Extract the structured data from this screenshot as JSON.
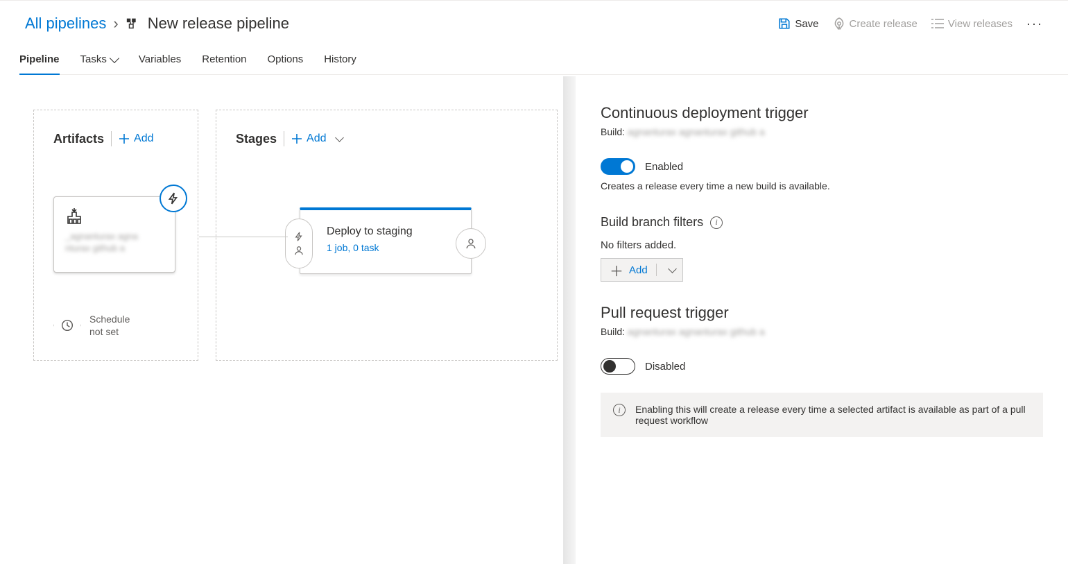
{
  "breadcrumb": {
    "root": "All pipelines",
    "title": "New release pipeline"
  },
  "header": {
    "save": "Save",
    "create": "Create release",
    "view": "View releases"
  },
  "tabs": [
    "Pipeline",
    "Tasks",
    "Variables",
    "Retention",
    "Options",
    "History"
  ],
  "artifacts": {
    "title": "Artifacts",
    "add": "Add",
    "source_masked": "_agnanturax agna nturax github a",
    "schedule": "Schedule\nnot set"
  },
  "stages": {
    "title": "Stages",
    "add": "Add",
    "stage": {
      "name": "Deploy to staging",
      "sub": "1 job, 0 task"
    }
  },
  "panel": {
    "cd_title": "Continuous deployment trigger",
    "build_label": "Build:",
    "build_masked": "agnanturax agnanturax github a",
    "toggle_on": "Enabled",
    "cd_desc": "Creates a release every time a new build is available.",
    "branch_title": "Build branch filters",
    "no_filters": "No filters added.",
    "add": "Add",
    "pr_title": "Pull request trigger",
    "toggle_off": "Disabled",
    "pr_info": "Enabling this will create a release every time a selected artifact is available as part of a pull request workflow"
  }
}
